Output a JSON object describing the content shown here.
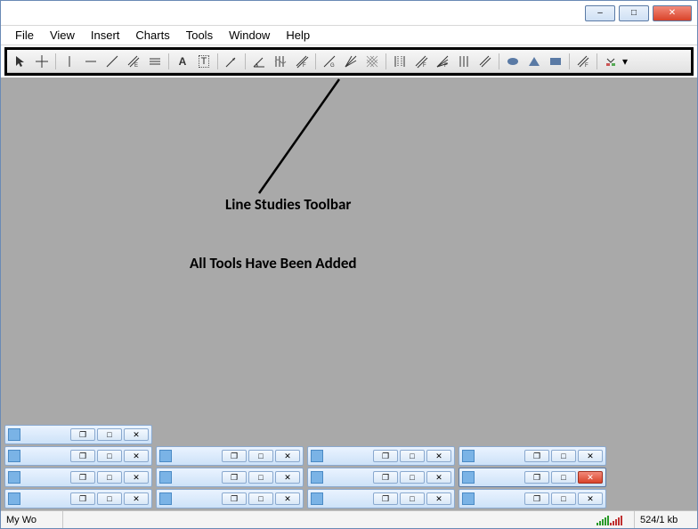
{
  "titlebar": {
    "minimize": "–",
    "maximize": "□",
    "close": "✕"
  },
  "menu": {
    "file": "File",
    "view": "View",
    "insert": "Insert",
    "charts": "Charts",
    "tools": "Tools",
    "window": "Window",
    "help": "Help"
  },
  "toolbar_icons": {
    "cursor": "cursor",
    "crosshair": "crosshair",
    "vline": "|",
    "hline": "—",
    "trend": "/",
    "equidistant": "//E",
    "channel": "≡",
    "text": "A",
    "textlabel": "T",
    "arrows": "↗",
    "angle": "∠",
    "cycle": "⟂",
    "regression": "//F",
    "gann_line": "/G",
    "gann_fan": "✳",
    "gann_grid": "▦",
    "fibo_retr": "||",
    "fibo_chan": "/F",
    "fibo_fan": "✲F",
    "fibo_arcs": "|||",
    "fibo_exp": "//",
    "ellipse": "○",
    "triangle": "▲",
    "rectangle": "■",
    "fibo_time": "//F",
    "shapes_menu": "◆▾"
  },
  "annotation": {
    "line_studies": "Line Studies Toolbar",
    "all_tools": "All Tools Have Been Added"
  },
  "mini_rows": [
    {
      "count": 1,
      "active_index": -1
    },
    {
      "count": 4,
      "active_index": -1
    },
    {
      "count": 4,
      "active_index": 3
    },
    {
      "count": 4,
      "active_index": -1
    }
  ],
  "mini": {
    "restore": "❐",
    "max": "□",
    "close": "✕"
  },
  "status": {
    "left": "My Wo",
    "kb": "524/1 kb"
  }
}
